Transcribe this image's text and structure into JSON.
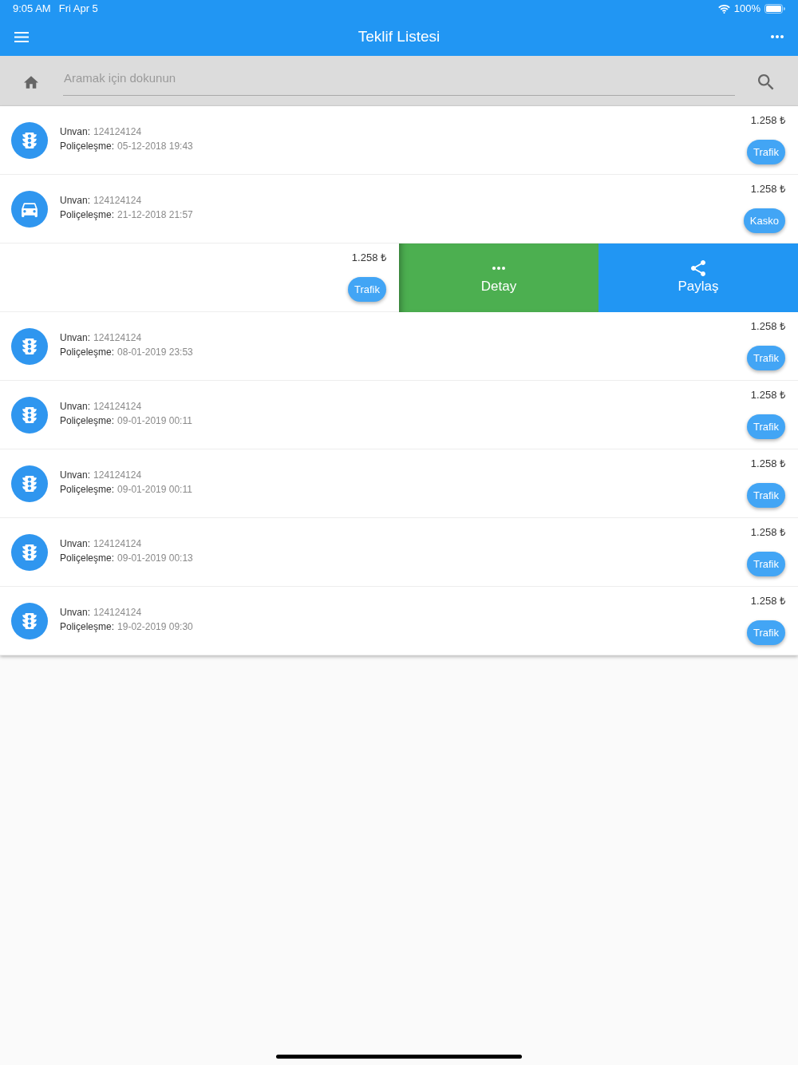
{
  "status_bar": {
    "time": "9:05 AM",
    "date": "Fri Apr 5",
    "battery": "100%"
  },
  "app_bar": {
    "title": "Teklif Listesi"
  },
  "search": {
    "placeholder": "Aramak için dokunun"
  },
  "offers": [
    {
      "kind": "traffic",
      "swiped": false,
      "unvan_label": "Unvan:",
      "unvan": "124124124",
      "date_label": "Poliçeleşme:",
      "date": "05-12-2018 19:43",
      "price": "1.258 ₺",
      "type": "Trafik"
    },
    {
      "kind": "car",
      "swiped": false,
      "unvan_label": "Unvan:",
      "unvan": "124124124",
      "date_label": "Poliçeleşme:",
      "date": "21-12-2018 21:57",
      "price": "1.258 ₺",
      "type": "Kasko"
    },
    {
      "swiped": true,
      "price": "1.258 ₺",
      "type": "Trafik",
      "actions": [
        {
          "kind": "detail",
          "label": "Detay"
        },
        {
          "kind": "share",
          "label": "Paylaş"
        }
      ]
    },
    {
      "kind": "traffic",
      "swiped": false,
      "unvan_label": "Unvan:",
      "unvan": "124124124",
      "date_label": "Poliçeleşme:",
      "date": "08-01-2019 23:53",
      "price": "1.258 ₺",
      "type": "Trafik"
    },
    {
      "kind": "traffic",
      "swiped": false,
      "unvan_label": "Unvan:",
      "unvan": "124124124",
      "date_label": "Poliçeleşme:",
      "date": "09-01-2019 00:11",
      "price": "1.258 ₺",
      "type": "Trafik"
    },
    {
      "kind": "traffic",
      "swiped": false,
      "unvan_label": "Unvan:",
      "unvan": "124124124",
      "date_label": "Poliçeleşme:",
      "date": "09-01-2019 00:11",
      "price": "1.258 ₺",
      "type": "Trafik"
    },
    {
      "kind": "traffic",
      "swiped": false,
      "unvan_label": "Unvan:",
      "unvan": "124124124",
      "date_label": "Poliçeleşme:",
      "date": "09-01-2019 00:13",
      "price": "1.258 ₺",
      "type": "Trafik"
    },
    {
      "kind": "traffic",
      "swiped": false,
      "unvan_label": "Unvan:",
      "unvan": "124124124",
      "date_label": "Poliçeleşme:",
      "date": "19-02-2019 09:30",
      "price": "1.258 ₺",
      "type": "Trafik"
    }
  ]
}
